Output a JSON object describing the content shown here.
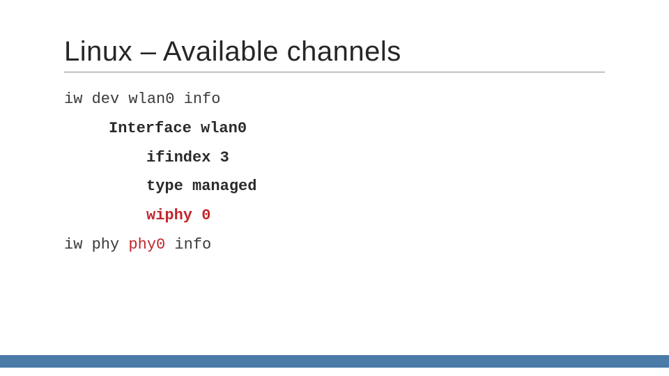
{
  "title": "Linux – Available channels",
  "lines": {
    "l1": "iw dev wlan0 info",
    "l2": "Interface wlan0",
    "l3": "ifindex 3",
    "l4": "type managed",
    "l5": "wiphy 0",
    "l6a": "iw phy ",
    "l6b": "phy0",
    "l6c": " info"
  }
}
